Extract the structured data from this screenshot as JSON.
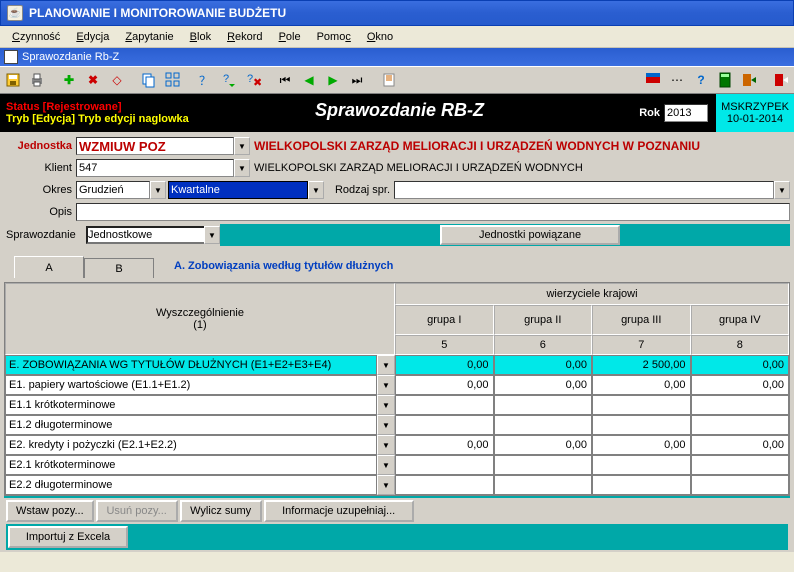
{
  "window": {
    "title": "PLANOWANIE I MONITOROWANIE BUDŻETU"
  },
  "menu": {
    "czynnosc": "Czynność",
    "edycja": "Edycja",
    "zapytanie": "Zapytanie",
    "blok": "Blok",
    "rekord": "Rekord",
    "pole": "Pole",
    "pomoc": "Pomoc",
    "okno": "Okno"
  },
  "child": {
    "title": "Sprawozdanie Rb-Z"
  },
  "status": {
    "line1": "Status [Rejestrowane]",
    "line2": "Tryb [Edycja] Tryb edycji naglowka",
    "bigtitle": "Sprawozdanie RB-Z",
    "rok_label": "Rok",
    "rok_value": "2013",
    "user": "MSKRZYPEK",
    "date": "10-01-2014"
  },
  "form": {
    "jednostka_label": "Jednostka",
    "jednostka_value": "WZMIUW POZ",
    "jednostka_full": "WIELKOPOLSKI ZARZĄD MELIORACJI I URZĄDZEŃ WODNYCH W POZNANIU",
    "klient_label": "Klient",
    "klient_value": "547",
    "klient_full": "WIELKOPOLSKI ZARZĄD MELIORACJI I URZĄDZEŃ WODNYCH",
    "okres_label": "Okres",
    "okres_value": "Grudzień",
    "okres_type": "Kwartalne",
    "rodzaj_label": "Rodzaj spr.",
    "rodzaj_value": "",
    "opis_label": "Opis",
    "opis_value": "",
    "spraw_label": "Sprawozdanie",
    "spraw_value": "Jednostkowe",
    "btn_powiazane": "Jednostki powiązane"
  },
  "tabs": {
    "a": "A",
    "b": "B",
    "section_title": "A. Zobowiązania według tytułów dłużnych"
  },
  "grid": {
    "left_header_1": "Wyszczególnienie",
    "left_header_2": "(1)",
    "top_header": "wierzyciele krajowi",
    "groups": [
      "grupa I",
      "grupa II",
      "grupa III",
      "grupa IV"
    ],
    "nums": [
      "5",
      "6",
      "7",
      "8"
    ],
    "rows": [
      {
        "label": "E. ZOBOWIĄZANIA WG TYTUŁÓW DŁUŻNYCH (E1+E2+E3+E4)",
        "hl": true,
        "vals": [
          "0,00",
          "0,00",
          "2 500,00",
          "0,00"
        ]
      },
      {
        "label": "E1. papiery wartościowe (E1.1+E1.2)",
        "hl": false,
        "vals": [
          "0,00",
          "0,00",
          "0,00",
          "0,00"
        ]
      },
      {
        "label": "E1.1 krótkoterminowe",
        "hl": false,
        "vals": [
          "",
          "",
          "",
          ""
        ]
      },
      {
        "label": "E1.2 długoterminowe",
        "hl": false,
        "vals": [
          "",
          "",
          "",
          ""
        ]
      },
      {
        "label": "E2. kredyty i pożyczki (E2.1+E2.2)",
        "hl": false,
        "vals": [
          "0,00",
          "0,00",
          "0,00",
          "0,00"
        ]
      },
      {
        "label": "E2.1 krótkoterminowe",
        "hl": false,
        "vals": [
          "",
          "",
          "",
          ""
        ]
      },
      {
        "label": "E2.2 długoterminowe",
        "hl": false,
        "vals": [
          "",
          "",
          "",
          ""
        ]
      }
    ]
  },
  "bottom": {
    "wstaw": "Wstaw pozy...",
    "usun": "Usuń pozy...",
    "wylicz": "Wylicz sumy",
    "uzup": "Informacje uzupełniaj...",
    "excel": "Importuj z Excela"
  }
}
